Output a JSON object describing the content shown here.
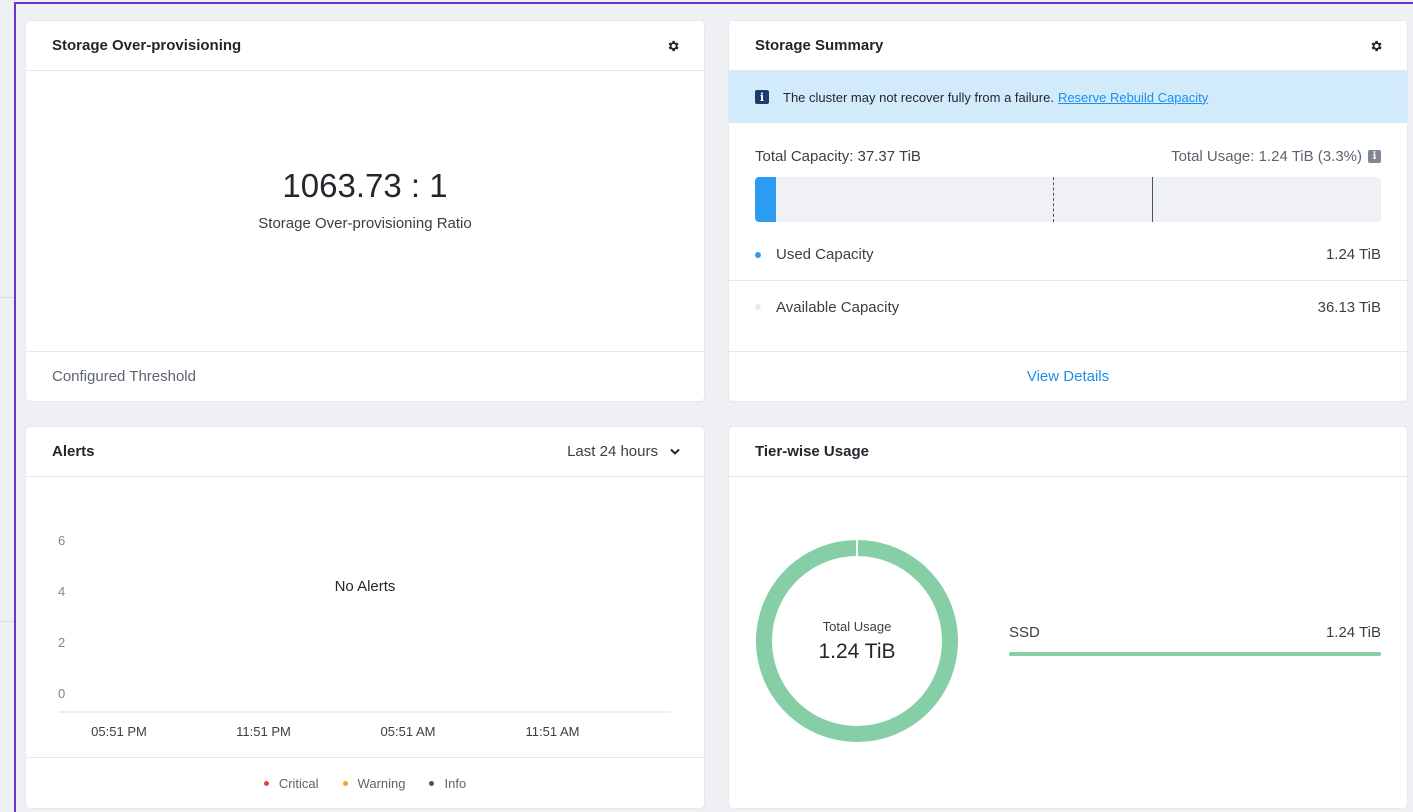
{
  "colors": {
    "accent": "#1b8ff0",
    "used": "#2b9cf2",
    "available": "#e8eaee",
    "ssd": "#86cea6",
    "critical": "#e8453c",
    "warning": "#f5a623",
    "info": "#4c5563"
  },
  "overprovisioning": {
    "title": "Storage Over-provisioning",
    "settings_icon": "gear-icon",
    "ratio": "1063.73 : 1",
    "ratio_label": "Storage Over-provisioning Ratio",
    "footer": "Configured Threshold"
  },
  "summary": {
    "title": "Storage Summary",
    "settings_icon": "gear-icon",
    "banner_icon": "info-icon",
    "banner_text": "The cluster may not recover fully from a failure.",
    "banner_link": "Reserve Rebuild Capacity",
    "total_capacity": "Total Capacity: 37.37 TiB",
    "total_usage": "Total Usage: 1.24 TiB (3.3%)",
    "used_fraction": 0.033,
    "legend": [
      {
        "label": "Used Capacity",
        "value": "1.24 TiB",
        "color": "#2b9cf2"
      },
      {
        "label": "Available Capacity",
        "value": "36.13 TiB",
        "color": "#e8eaee"
      }
    ],
    "view_details": "View Details"
  },
  "alerts": {
    "title": "Alerts",
    "range": "Last 24 hours",
    "empty_text": "No Alerts",
    "chart_data": {
      "type": "bar",
      "title": "",
      "xlabel": "",
      "ylabel": "",
      "categories": [
        "05:51 PM",
        "11:51 PM",
        "05:51 AM",
        "11:51 AM"
      ],
      "yticks": [
        "0",
        "2",
        "4",
        "6"
      ],
      "ylim": [
        0,
        6
      ],
      "series": [
        {
          "name": "Critical",
          "values": [
            0,
            0,
            0,
            0
          ]
        },
        {
          "name": "Warning",
          "values": [
            0,
            0,
            0,
            0
          ]
        },
        {
          "name": "Info",
          "values": [
            0,
            0,
            0,
            0
          ]
        }
      ],
      "legend_placement": "bottom",
      "grid": false
    },
    "legend": [
      {
        "label": "Critical",
        "color": "#e8453c"
      },
      {
        "label": "Warning",
        "color": "#f5a623"
      },
      {
        "label": "Info",
        "color": "#4c5563"
      }
    ]
  },
  "tier": {
    "title": "Tier-wise Usage",
    "donut_label": "Total Usage",
    "donut_value": "1.24 TiB",
    "tiers": [
      {
        "name": "SSD",
        "value": "1.24 TiB",
        "fraction": 1.0
      }
    ]
  }
}
